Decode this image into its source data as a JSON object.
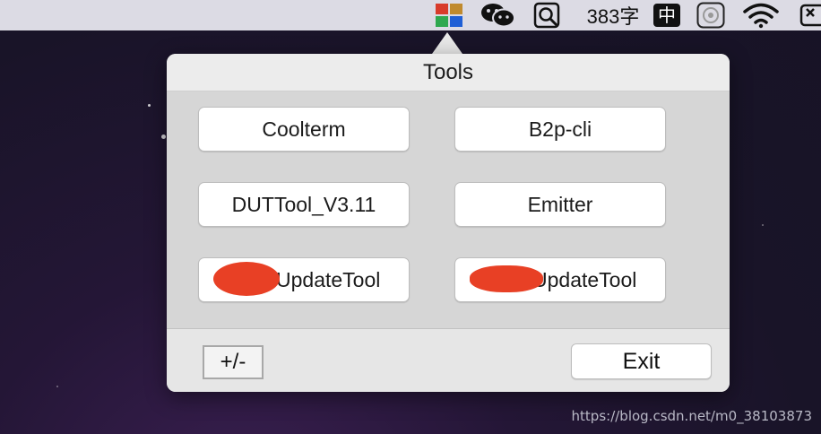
{
  "menubar": {
    "app_icon": "ms-office-icon",
    "wechat_icon": "wechat-icon",
    "search_icon": "search-icon",
    "word_count": "383字",
    "input_method": "中",
    "input_method_icon": "input-method-icon",
    "record_icon": "record-icon",
    "wifi_icon": "wifi-icon",
    "battery_icon": "battery-icon"
  },
  "popover": {
    "title": "Tools",
    "buttons": [
      {
        "label": "Coolterm"
      },
      {
        "label": "B2p-cli"
      },
      {
        "label": "DUTTool_V3.11"
      },
      {
        "label": "Emitter"
      },
      {
        "label": "UpdateTool"
      },
      {
        "label": "UpdateTool"
      }
    ],
    "plus_minus_label": "+/-",
    "exit_label": "Exit"
  },
  "colors": {
    "redaction": "#e84025",
    "popover_bg": "#e6e6e6",
    "grid_bg": "#d6d6d6"
  },
  "watermark": "https://blog.csdn.net/m0_38103873"
}
